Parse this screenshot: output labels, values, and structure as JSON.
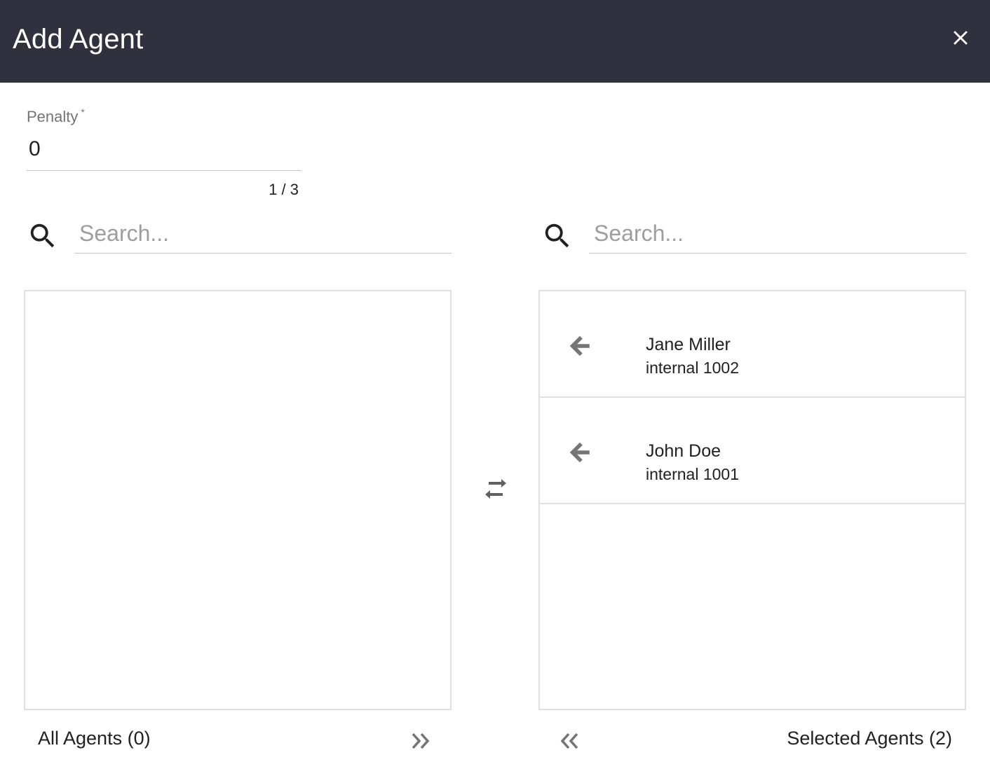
{
  "dialog": {
    "title": "Add Agent",
    "close_icon": "close-icon"
  },
  "penalty": {
    "label": "Penalty",
    "required_marker": "*",
    "value": "0",
    "counter": "1 / 3"
  },
  "left_panel": {
    "search_placeholder": "Search...",
    "search_icon": "search-icon",
    "footer_label": "All Agents (0)",
    "move_all_icon": "double-chevron-right-icon",
    "items": []
  },
  "right_panel": {
    "search_placeholder": "Search...",
    "search_icon": "search-icon",
    "footer_label": "Selected Agents (2)",
    "move_all_icon": "double-chevron-left-icon",
    "items": [
      {
        "name": "Jane Miller",
        "extension": "internal 1002",
        "icon": "arrow-left-icon"
      },
      {
        "name": "John Doe",
        "extension": "internal 1001",
        "icon": "arrow-left-icon"
      }
    ]
  },
  "swap_icon": "swap-horizontal-icon",
  "colors": {
    "header_bg": "#2f323e",
    "icon_gray": "#757575",
    "border": "#e0e0e0"
  }
}
